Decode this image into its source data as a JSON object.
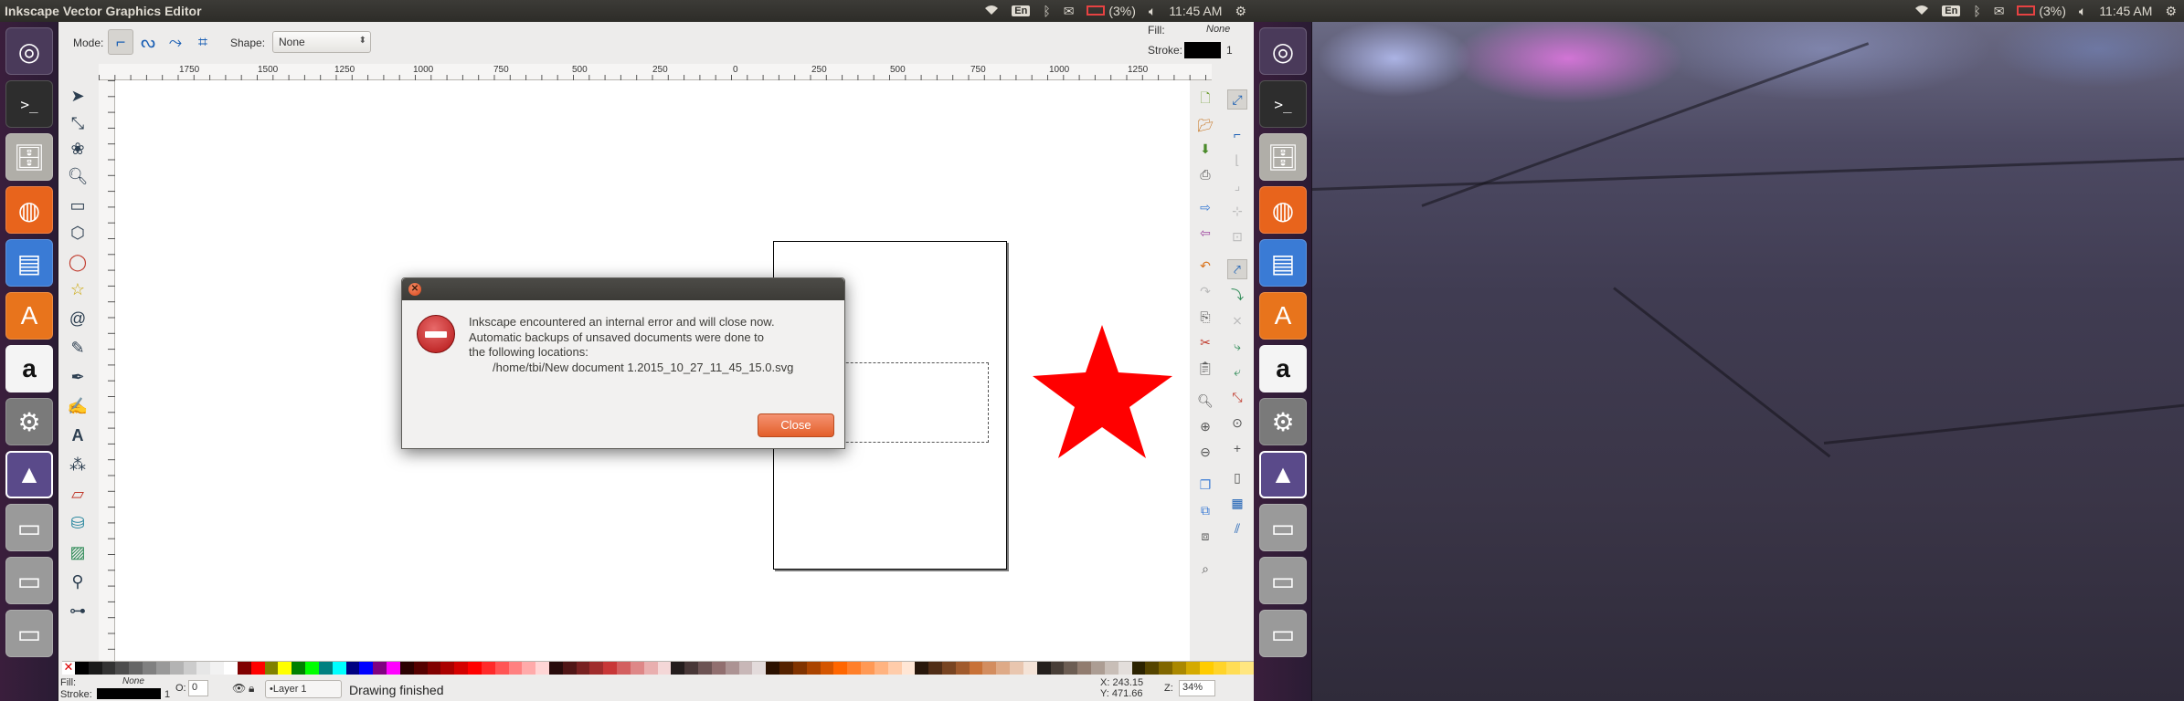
{
  "panel": {
    "title": "Inkscape Vector Graphics Editor",
    "keyboard": "En",
    "battery": "(3%)",
    "time": "11:45 AM"
  },
  "toolbar": {
    "mode_label": "Mode:",
    "shape_label": "Shape:",
    "shape_value": "None",
    "fill_label": "Fill:",
    "fill_value": "None",
    "stroke_label": "Stroke:",
    "stroke_width": "1"
  },
  "ruler": {
    "labels": [
      "1750",
      "1500",
      "1250",
      "1000",
      "750",
      "500",
      "250",
      "0",
      "250",
      "500",
      "750",
      "1000",
      "1250"
    ]
  },
  "dialog": {
    "line1": "Inkscape encountered an internal error and will close now.",
    "line2": "Automatic backups of unsaved documents were done to",
    "line3": "the following locations:",
    "path": "/home/tbi/New document 1.2015_10_27_11_45_15.0.svg",
    "close_button": "Close"
  },
  "statusbar": {
    "fill_label": "Fill:",
    "fill_value": "None",
    "stroke_label": "Stroke:",
    "stroke_width": "1",
    "opacity_label": "O:",
    "opacity_value": "0",
    "layer": "•Layer 1",
    "message": "Drawing finished",
    "x_label": "X:",
    "x_value": "243.15",
    "y_label": "Y:",
    "y_value": "471.66",
    "zoom_label": "Z:",
    "zoom_value": "34%"
  },
  "palette": [
    "#000000",
    "#1a1a1a",
    "#333333",
    "#4d4d4d",
    "#666666",
    "#808080",
    "#999999",
    "#b3b3b3",
    "#cccccc",
    "#e6e6e6",
    "#f2f2f2",
    "#ffffff",
    "#800000",
    "#ff0000",
    "#808000",
    "#ffff00",
    "#008000",
    "#00ff00",
    "#008080",
    "#00ffff",
    "#000080",
    "#0000ff",
    "#800080",
    "#ff00ff",
    "#2b0000",
    "#550000",
    "#800000",
    "#aa0000",
    "#d40000",
    "#ff0000",
    "#ff2a2a",
    "#ff5555",
    "#ff8080",
    "#ffaaaa",
    "#ffd5d5",
    "#280b0b",
    "#501616",
    "#782121",
    "#a02c2c",
    "#c83737",
    "#d35f5f",
    "#de8787",
    "#e9afaf",
    "#f4d7d7",
    "#241c1c",
    "#483737",
    "#6c5353",
    "#916f6f",
    "#ac9393",
    "#c8b7b7",
    "#e3dbdb",
    "#2b1100",
    "#552200",
    "#803300",
    "#aa4400",
    "#d45500",
    "#ff6600",
    "#ff7f2a",
    "#ff9955",
    "#ffb380",
    "#ffccaa",
    "#ffe6d5",
    "#28170b",
    "#502d16",
    "#784421",
    "#a05a2c",
    "#c87137",
    "#d38d5f",
    "#deaa87",
    "#e9c6af",
    "#f4e3d7",
    "#241f1c",
    "#483e37",
    "#6c5d53",
    "#917c6f",
    "#ac9d93",
    "#c8beb7",
    "#e3dedb",
    "#2b2200",
    "#554400",
    "#806600",
    "#aa8800",
    "#d4aa00",
    "#ffcc00",
    "#ffd42a",
    "#ffdd55",
    "#ffe680"
  ],
  "icons": {
    "launcher": [
      "ubuntu-dash-icon",
      "terminal-icon",
      "file-manager-icon",
      "firefox-icon",
      "writer-icon",
      "software-center-icon",
      "amazon-icon",
      "system-settings-icon",
      "inkscape-icon",
      "drive-icon",
      "drive-icon",
      "drive-icon"
    ]
  },
  "colors": {
    "accent_orange": "#e8743b",
    "star_red": "#ff0000",
    "error_red": "#c41a1a"
  }
}
